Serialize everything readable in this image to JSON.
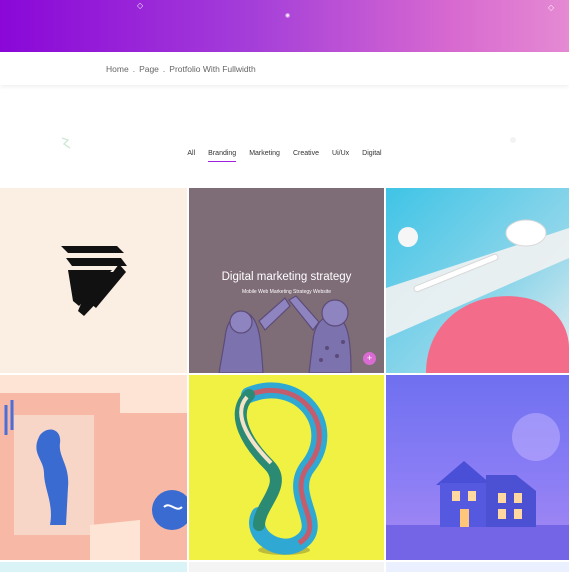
{
  "breadcrumb": {
    "items": [
      "Home",
      "Page",
      "Protfolio With Fullwidth"
    ],
    "separator": "."
  },
  "filters": {
    "items": [
      "All",
      "Branding",
      "Marketing",
      "Creative",
      "Ui/Ux",
      "Digital"
    ],
    "active": "Branding"
  },
  "portfolio": {
    "featured_title": "Digital marketing strategy",
    "featured_subtitle": "Mobile Web Marketing Strategy Website",
    "link_icon": "+"
  },
  "colors": {
    "accent": "#a020e0",
    "hero_start": "#8a07d8",
    "hero_end": "#e58ad3",
    "link_button": "#d96bd3"
  }
}
